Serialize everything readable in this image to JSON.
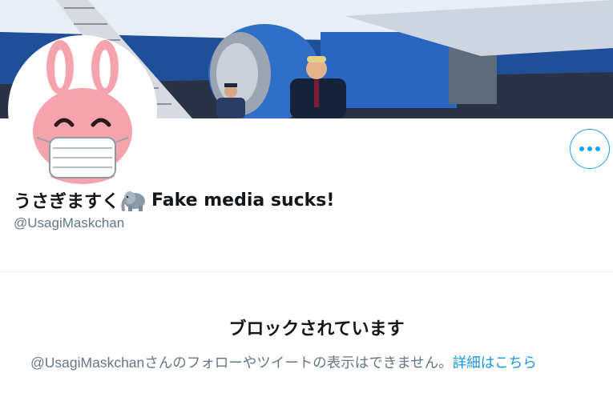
{
  "profile": {
    "display_name": "うさぎますく",
    "name_emoji": "elephant-icon",
    "name_suffix": "Fake media sucks!",
    "handle": "@UsagiMaskchan"
  },
  "blocked": {
    "title": "ブロックされています",
    "message": "@UsagiMaskchanさんのフォローやツイートの表示はできません。",
    "learn_more": "詳細はこちら"
  },
  "colors": {
    "accent": "#1da1f2",
    "link": "#1b95e0",
    "secondary_text": "#657786",
    "primary_text": "#14171a"
  }
}
